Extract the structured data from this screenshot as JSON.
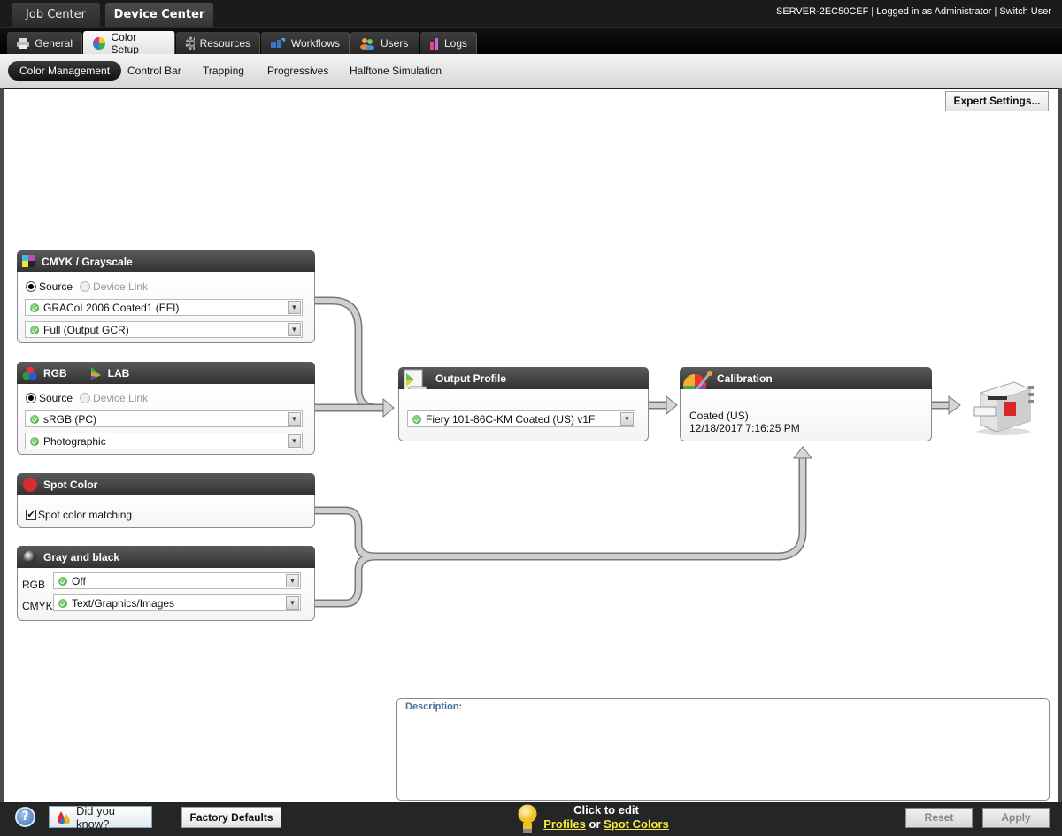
{
  "header": {
    "center_tabs": [
      {
        "label": "Job Center",
        "active": false
      },
      {
        "label": "Device Center",
        "active": true
      }
    ],
    "server_name": "SERVER-2EC50CEF",
    "login_status": "Logged in as Administrator",
    "switch_user": "Switch User"
  },
  "device_tabs": [
    {
      "label": "General",
      "icon": "printer-icon",
      "active": false
    },
    {
      "label": "Color Setup",
      "icon": "color-wheel-icon",
      "active": true
    },
    {
      "label": "Resources",
      "icon": "gear-icon",
      "active": false
    },
    {
      "label": "Workflows",
      "icon": "workflow-icon",
      "active": false
    },
    {
      "label": "Users",
      "icon": "users-icon",
      "active": false
    },
    {
      "label": "Logs",
      "icon": "bar-chart-icon",
      "active": false
    }
  ],
  "sub_nav": [
    {
      "label": "Color Management",
      "active": true
    },
    {
      "label": "Control Bar",
      "active": false
    },
    {
      "label": "Trapping",
      "active": false
    },
    {
      "label": "Progressives",
      "active": false
    },
    {
      "label": "Halftone Simulation",
      "active": false
    }
  ],
  "expert_settings": "Expert Settings...",
  "panels": {
    "cmyk": {
      "title": "CMYK / Grayscale",
      "radio_source": "Source",
      "radio_device_link": "Device Link",
      "selected_radio": "Source",
      "profile": "GRACoL2006 Coated1 (EFI)",
      "rendering": "Full (Output GCR)"
    },
    "rgb": {
      "title_rgb": "RGB",
      "title_lab": "LAB",
      "radio_source": "Source",
      "radio_device_link": "Device Link",
      "selected_radio": "Source",
      "profile": "sRGB (PC)",
      "rendering": "Photographic"
    },
    "spot": {
      "title": "Spot Color",
      "checkbox_label": "Spot color matching",
      "checked": true
    },
    "gray": {
      "title": "Gray and black",
      "rgb_label": "RGB",
      "rgb_value": "Off",
      "cmyk_label": "CMYK",
      "cmyk_value": "Text/Graphics/Images"
    },
    "output": {
      "title": "Output Profile",
      "profile": "Fiery 101-86C-KM Coated (US) v1F"
    },
    "calibration": {
      "title": "Calibration",
      "name": "Coated (US)",
      "date": "12/18/2017 7:16:25 PM"
    }
  },
  "description": {
    "label": "Description:",
    "text": ""
  },
  "footer": {
    "help": "?",
    "did_you_know": "Did you know?",
    "factory_defaults": "Factory Defaults",
    "click_to_edit": "Click to edit",
    "profiles_link": "Profiles",
    "or": "or",
    "spot_colors_link": "Spot Colors",
    "reset": "Reset",
    "apply": "Apply"
  }
}
